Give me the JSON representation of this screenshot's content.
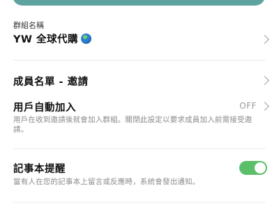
{
  "group_name": {
    "label": "群組名稱",
    "value": "YW 全球代購",
    "icon": "globe-icon"
  },
  "members": {
    "title": "成員名單 - 邀請"
  },
  "auto_join": {
    "title": "用戶自動加入",
    "status": "OFF",
    "description": "用戶在收到邀請後就會加入群組。關閉此設定以要求成員加入前需接受邀請。"
  },
  "notebook_reminder": {
    "title": "記事本提醒",
    "description": "當有人在您的記事本上留言或反應時，系統會發出通知。",
    "enabled": true
  },
  "colors": {
    "accent_bar": "#5fa3a0",
    "toggle_on": "#5bbf69"
  }
}
